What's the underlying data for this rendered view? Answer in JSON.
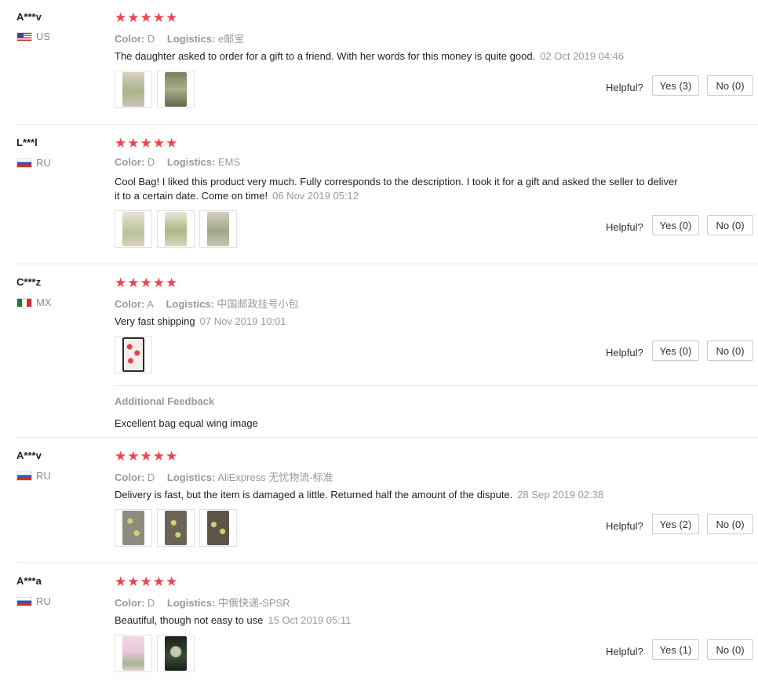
{
  "stars": "★★★★★",
  "helpful_label": "Helpful?",
  "reviews": [
    {
      "user": "A***v",
      "country": "US",
      "flag": "us",
      "color_label": "Color:",
      "color": "D",
      "logistics_label": "Logistics:",
      "logistics": "e邮宝",
      "text": "The daughter asked to order for a gift to a friend. With her words for this money is quite good.",
      "date": "02 Oct 2019 04:46",
      "yes": "Yes (3)",
      "no": "No (0)",
      "thumbs": [
        "photo of bag",
        "photo of bag"
      ]
    },
    {
      "user": "L***l",
      "country": "RU",
      "flag": "ru",
      "color_label": "Color:",
      "color": "D",
      "logistics_label": "Logistics:",
      "logistics": "EMS",
      "text": "Cool Bag! I liked this product very much. Fully corresponds to the description. I took it for a gift and asked the seller to deliver it to a certain date. Come on time!",
      "date": "06 Nov 2019 05:12",
      "yes": "Yes (0)",
      "no": "No (0)",
      "thumbs": [
        "photo of bag",
        "photo of bag",
        "photo of bag"
      ]
    },
    {
      "user": "C***z",
      "country": "MX",
      "flag": "mx",
      "color_label": "Color:",
      "color": "A",
      "logistics_label": "Logistics:",
      "logistics": "中国邮政挂号小包",
      "text": "Very fast shipping",
      "date": "07 Nov 2019 10:01",
      "yes": "Yes (0)",
      "no": "No (0)",
      "thumbs": [
        "photo of bag"
      ],
      "additional_title": "Additional Feedback",
      "additional_text": "Excellent bag equal wing image"
    },
    {
      "user": "A***v",
      "country": "RU",
      "flag": "ru",
      "color_label": "Color:",
      "color": "D",
      "logistics_label": "Logistics:",
      "logistics": "AliExpress 无忧物流-标准",
      "text": "Delivery is fast, but the item is damaged a little. Returned half the amount of the dispute.",
      "date": "28 Sep 2019 02:38",
      "yes": "Yes (2)",
      "no": "No (0)",
      "thumbs": [
        "photo of bag",
        "photo of bag",
        "photo of bag"
      ]
    },
    {
      "user": "A***a",
      "country": "RU",
      "flag": "ru",
      "color_label": "Color:",
      "color": "D",
      "logistics_label": "Logistics:",
      "logistics": "中俄快递-SPSR",
      "text": "Beautiful, though not easy to use",
      "date": "15 Oct 2019 05:11",
      "yes": "Yes (1)",
      "no": "No (0)",
      "thumbs": [
        "photo of bag",
        "photo of bag"
      ]
    }
  ]
}
